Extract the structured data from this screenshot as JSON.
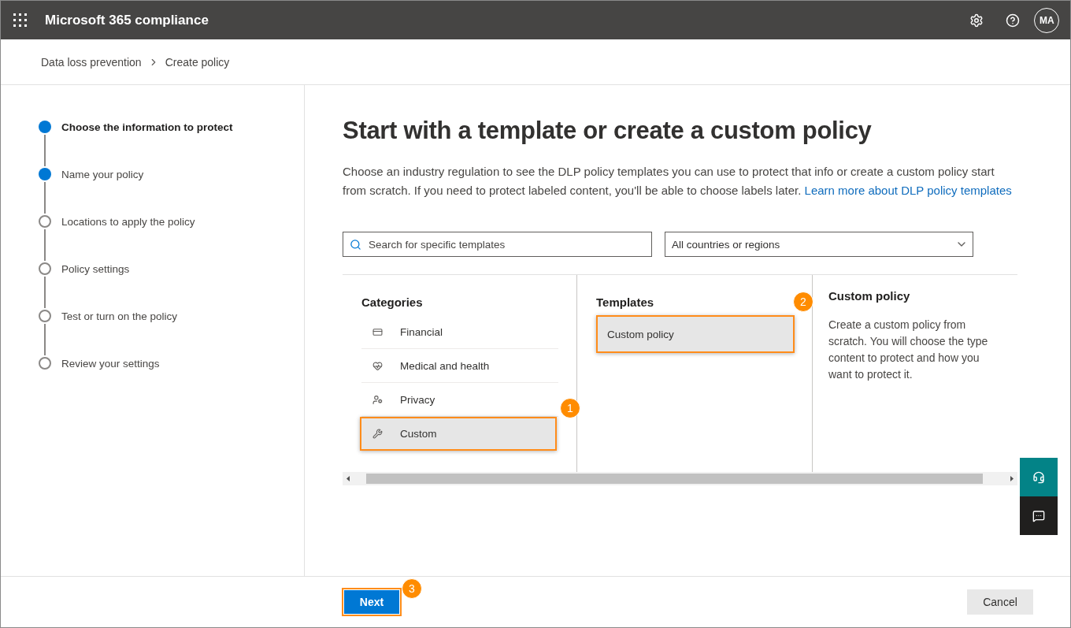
{
  "header": {
    "title": "Microsoft 365 compliance",
    "avatar": "MA"
  },
  "breadcrumb": [
    "Data loss prevention",
    "Create policy"
  ],
  "steps": [
    {
      "label": "Choose the information to protect",
      "filled": true,
      "selected": true
    },
    {
      "label": "Name your policy",
      "filled": true,
      "selected": false
    },
    {
      "label": "Locations to apply the policy",
      "filled": false,
      "selected": false
    },
    {
      "label": "Policy settings",
      "filled": false,
      "selected": false
    },
    {
      "label": "Test or turn on the policy",
      "filled": false,
      "selected": false
    },
    {
      "label": "Review your settings",
      "filled": false,
      "selected": false
    }
  ],
  "heading": "Start with a template or create a custom policy",
  "description": {
    "text": "Choose an industry regulation to see the DLP policy templates you can use to protect that info or create a custom policy start from scratch. If you need to protect labeled content, you'll be able to choose labels later.",
    "link": "Learn more about DLP policy templates"
  },
  "search": {
    "placeholder": "Search for specific templates"
  },
  "region_dropdown": {
    "value": "All countries or regions"
  },
  "categories": {
    "title": "Categories",
    "items": [
      {
        "label": "Financial",
        "kind": "financial",
        "selected": false
      },
      {
        "label": "Medical and health",
        "kind": "medical",
        "selected": false
      },
      {
        "label": "Privacy",
        "kind": "privacy",
        "selected": false
      },
      {
        "label": "Custom",
        "kind": "custom",
        "selected": true,
        "callout": "1"
      }
    ]
  },
  "templates": {
    "title": "Templates",
    "items": [
      {
        "label": "Custom policy",
        "selected": true,
        "callout": "2"
      }
    ]
  },
  "detail": {
    "title": "Custom policy",
    "lines": [
      "Create a custom policy from",
      "scratch. You will choose the type",
      "content to protect and how you",
      "want to protect it."
    ]
  },
  "footer": {
    "next": {
      "label": "Next",
      "callout": "3"
    },
    "cancel": "Cancel"
  }
}
